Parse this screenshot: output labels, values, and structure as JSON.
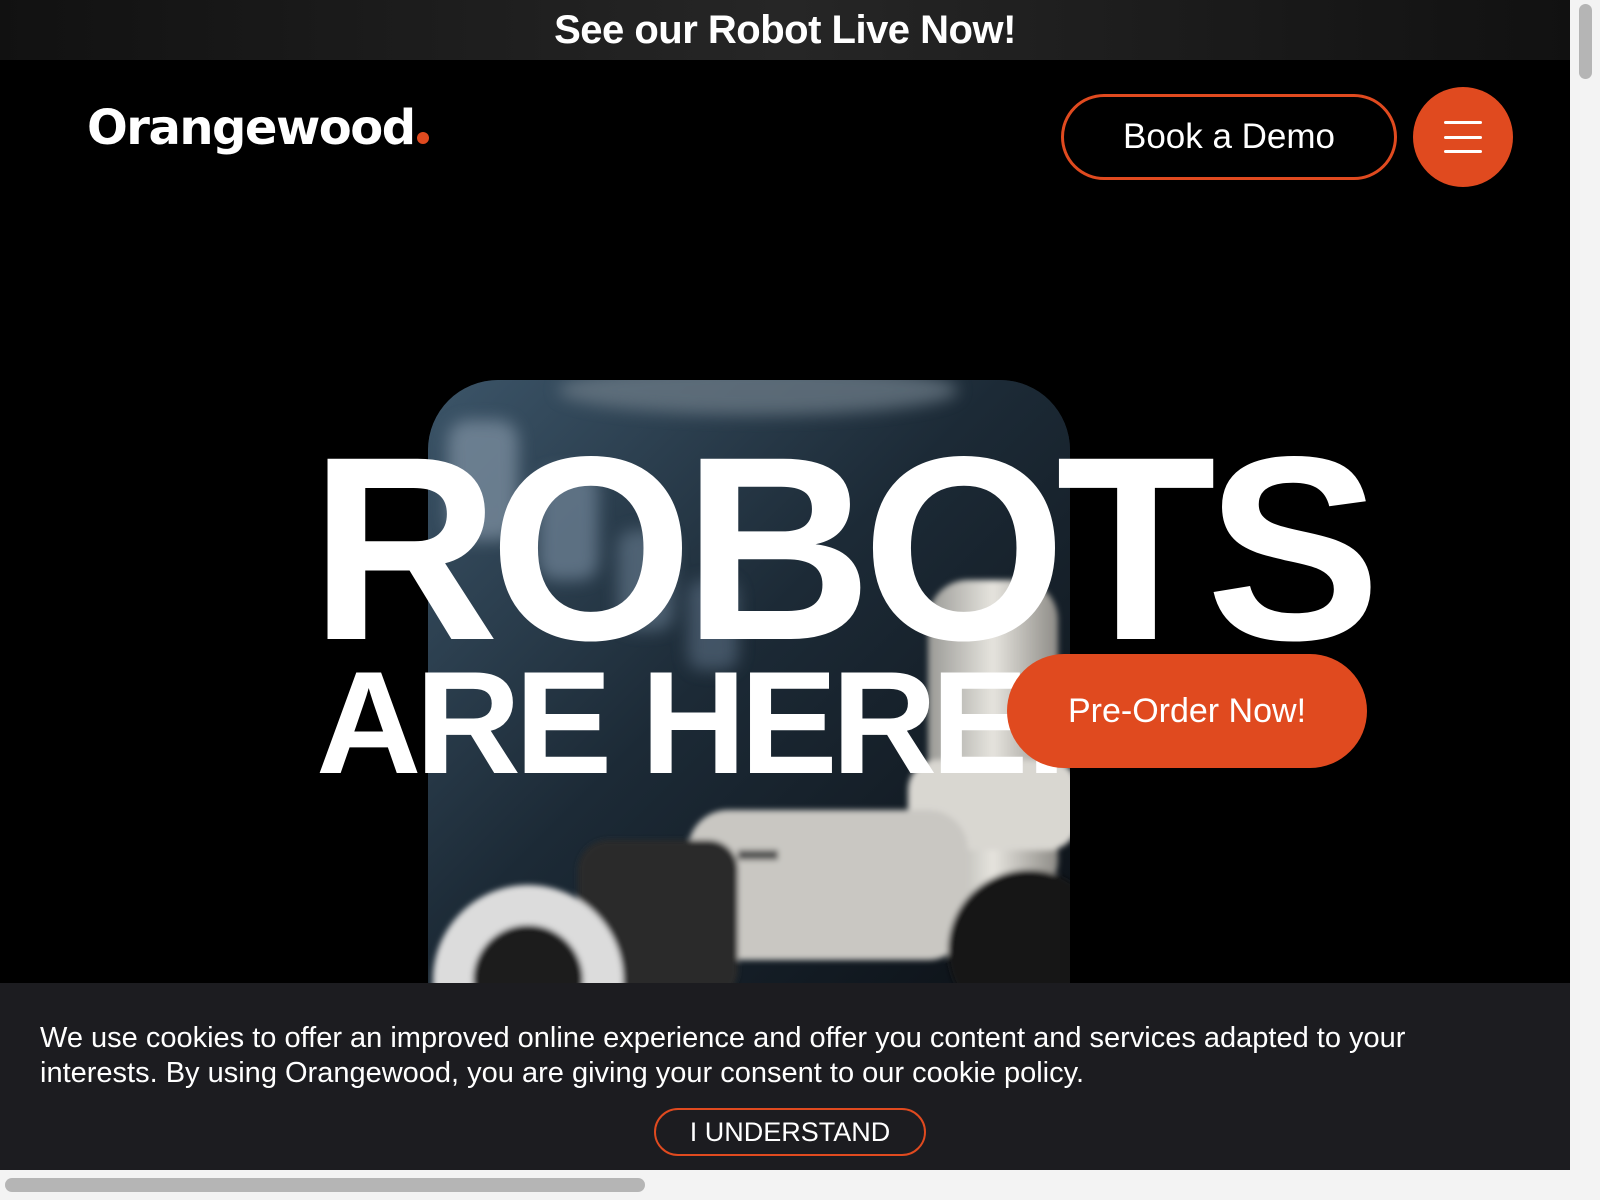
{
  "announcement": {
    "text": "See our Robot Live Now!"
  },
  "header": {
    "logo_text": "Orangewood",
    "book_demo_label": "Book a Demo",
    "menu_icon": "hamburger-menu-icon"
  },
  "hero": {
    "heading": "ROBOTS",
    "subheading": "ARE HERE!",
    "preorder_label": "Pre-Order Now!",
    "media": "robot-arm-video"
  },
  "cookie_banner": {
    "message": "We use cookies to offer an improved online experience and offer you content and services adapted to your interests. By using Orangewood, you are giving your consent to our cookie policy.",
    "accept_label": "I UNDERSTAND"
  },
  "colors": {
    "accent": "#e04a1f",
    "background": "#000000",
    "banner_background": "#1c1c20",
    "text": "#ffffff"
  }
}
